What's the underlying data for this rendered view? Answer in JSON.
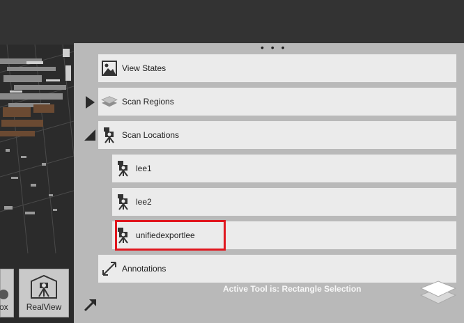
{
  "panel": {
    "grip": "• • •",
    "items": [
      {
        "label": "View States",
        "icon": "image-icon"
      },
      {
        "label": "Scan Regions",
        "icon": "layers-icon"
      },
      {
        "label": "Scan Locations",
        "icon": "tripod-camera-icon"
      },
      {
        "label": "lee1",
        "icon": "tripod-camera-icon"
      },
      {
        "label": "lee2",
        "icon": "tripod-camera-icon"
      },
      {
        "label": "unifiedexportlee",
        "icon": "tripod-camera-icon"
      },
      {
        "label": "Annotations",
        "icon": "diagonal-arrow-icon"
      }
    ],
    "active_tool": "Active Tool is: Rectangle Selection"
  },
  "toolbar": {
    "partial_label": "ox",
    "realview_label": "RealView"
  },
  "colors": {
    "panel_bg": "#b9b9b9",
    "row_bg": "#ebebeb",
    "highlight": "#e0161e",
    "dark_bg": "#333333"
  }
}
